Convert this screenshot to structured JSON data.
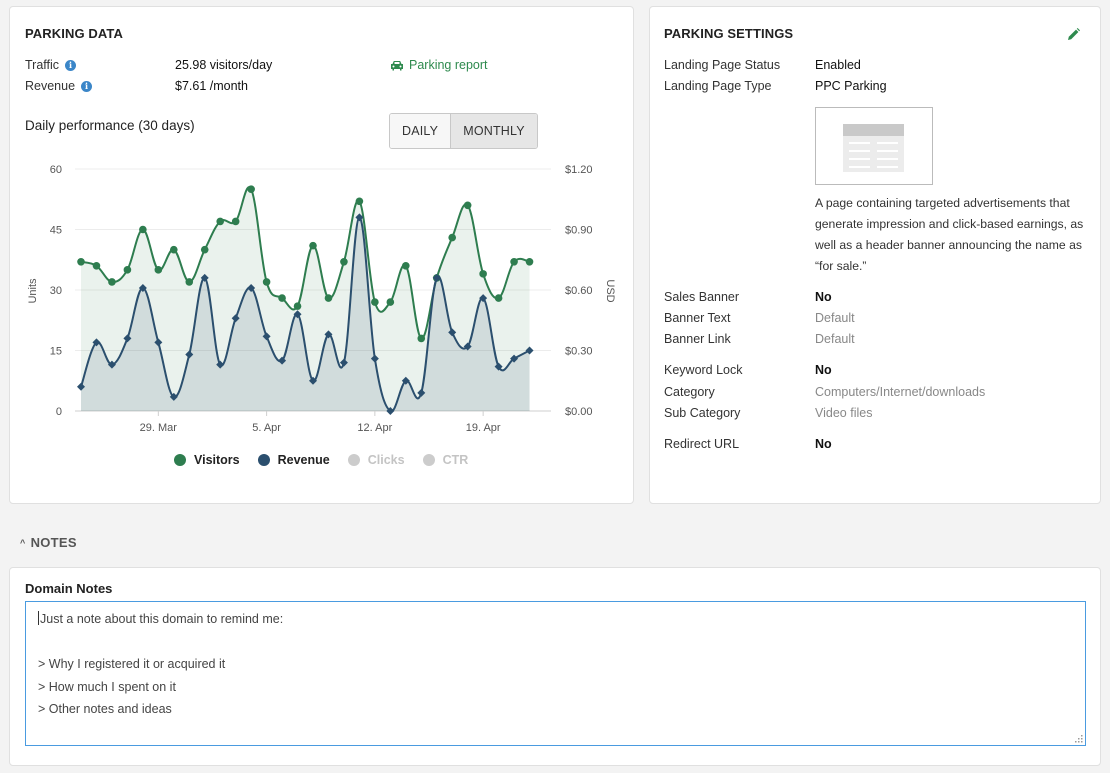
{
  "parking_data": {
    "title": "PARKING DATA",
    "traffic_label": "Traffic",
    "traffic_value": "25.98 visitors/day",
    "revenue_label": "Revenue",
    "revenue_value": "$7.61 /month",
    "report_link": "Parking report",
    "performance_title": "Daily performance (30 days)",
    "toggle": {
      "daily": "DAILY",
      "monthly": "MONTHLY",
      "selected": "MONTHLY"
    },
    "legend": [
      {
        "label": "Visitors",
        "color": "#2e7d4f",
        "active": true
      },
      {
        "label": "Revenue",
        "color": "#2b4f6e",
        "active": true
      },
      {
        "label": "Clicks",
        "color": "#cccccc",
        "active": false
      },
      {
        "label": "CTR",
        "color": "#cccccc",
        "active": false
      }
    ]
  },
  "chart_data": {
    "type": "area",
    "x": [
      "2024-03-24",
      "2024-03-25",
      "2024-03-26",
      "2024-03-27",
      "2024-03-28",
      "2024-03-29",
      "2024-03-30",
      "2024-03-31",
      "2024-04-01",
      "2024-04-02",
      "2024-04-03",
      "2024-04-04",
      "2024-04-05",
      "2024-04-06",
      "2024-04-07",
      "2024-04-08",
      "2024-04-09",
      "2024-04-10",
      "2024-04-11",
      "2024-04-12",
      "2024-04-13",
      "2024-04-14",
      "2024-04-15",
      "2024-04-16",
      "2024-04-17",
      "2024-04-18",
      "2024-04-19",
      "2024-04-20",
      "2024-04-21",
      "2024-04-22",
      "2024-04-23"
    ],
    "x_tick_labels": [
      {
        "date": "2024-03-29",
        "label": "29. Mar"
      },
      {
        "date": "2024-04-05",
        "label": "5. Apr"
      },
      {
        "date": "2024-04-12",
        "label": "12. Apr"
      },
      {
        "date": "2024-04-19",
        "label": "19. Apr"
      }
    ],
    "series": [
      {
        "name": "Visitors",
        "axis": "left",
        "color": "#2e7d4f",
        "values": [
          37,
          36,
          32,
          35,
          45,
          35,
          40,
          32,
          40,
          47,
          47,
          55,
          32,
          28,
          26,
          41,
          28,
          37,
          52,
          27,
          27,
          36,
          18,
          33,
          43,
          51,
          34,
          28,
          37,
          37
        ]
      },
      {
        "name": "Revenue",
        "axis": "right",
        "color": "#2b4f6e",
        "values": [
          0.12,
          0.34,
          0.23,
          0.36,
          0.61,
          0.34,
          0.07,
          0.28,
          0.66,
          0.23,
          0.46,
          0.61,
          0.37,
          0.25,
          0.48,
          0.15,
          0.38,
          0.24,
          0.96,
          0.26,
          0.0,
          0.15,
          0.09,
          0.66,
          0.39,
          0.32,
          0.56,
          0.22,
          0.26,
          0.3
        ]
      }
    ],
    "y_left": {
      "label": "Units",
      "ticks": [
        "0",
        "15",
        "30",
        "45",
        "60"
      ],
      "ylim": [
        0,
        60
      ]
    },
    "y_right": {
      "label": "USD",
      "ticks": [
        "$0.00",
        "$0.30",
        "$0.60",
        "$0.90",
        "$1.20"
      ],
      "ylim": [
        0,
        1.2
      ]
    },
    "grid": true
  },
  "parking_settings": {
    "title": "PARKING SETTINGS",
    "rows_top": [
      {
        "label": "Landing Page Status",
        "value": "Enabled"
      },
      {
        "label": "Landing Page Type",
        "value": "PPC Parking"
      }
    ],
    "landing_description": "A page containing targeted advertisements that generate impression and click-based earnings, as well as a header banner announcing the name as “for sale.”",
    "banner": [
      {
        "label": "Sales Banner",
        "value": "No",
        "muted": false
      },
      {
        "label": "Banner Text",
        "value": "Default",
        "muted": true
      },
      {
        "label": "Banner Link",
        "value": "Default",
        "muted": true
      }
    ],
    "keywords": [
      {
        "label": "Keyword Lock",
        "value": "No",
        "muted": false
      },
      {
        "label": "Category",
        "value": "Computers/Internet/downloads",
        "muted": true
      },
      {
        "label": "Sub Category",
        "value": "Video files",
        "muted": true
      }
    ],
    "redirect": {
      "label": "Redirect URL",
      "value": "No"
    }
  },
  "notes": {
    "section_toggle": "NOTES",
    "label": "Domain Notes",
    "lines": [
      "Just a note about this domain to remind me:",
      "",
      "> Why I registered it or acquired it",
      "> How much I spent on it",
      "> Other notes and ideas"
    ]
  }
}
